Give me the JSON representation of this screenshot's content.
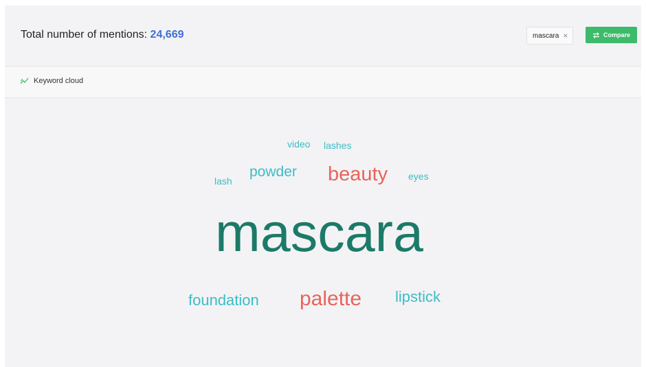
{
  "header": {
    "mentions_label": "Total number of mentions:",
    "mentions_count": "24,669",
    "keyword_chip": "mascara",
    "chip_close": "×",
    "compare_label": "Compare"
  },
  "section": {
    "title": "Keyword cloud",
    "icon": "trend-line-icon"
  },
  "colors": {
    "accent_blue": "#3f6ed6",
    "compare_green": "#3dbb6a",
    "word_dark_green": "#1c7a68",
    "word_teal": "#3bbdc4",
    "word_red": "#e8645a"
  },
  "keyword_cloud": {
    "words": [
      "video",
      "lashes",
      "lash",
      "powder",
      "beauty",
      "eyes",
      "mascara",
      "foundation",
      "palette",
      "lipstick"
    ]
  }
}
